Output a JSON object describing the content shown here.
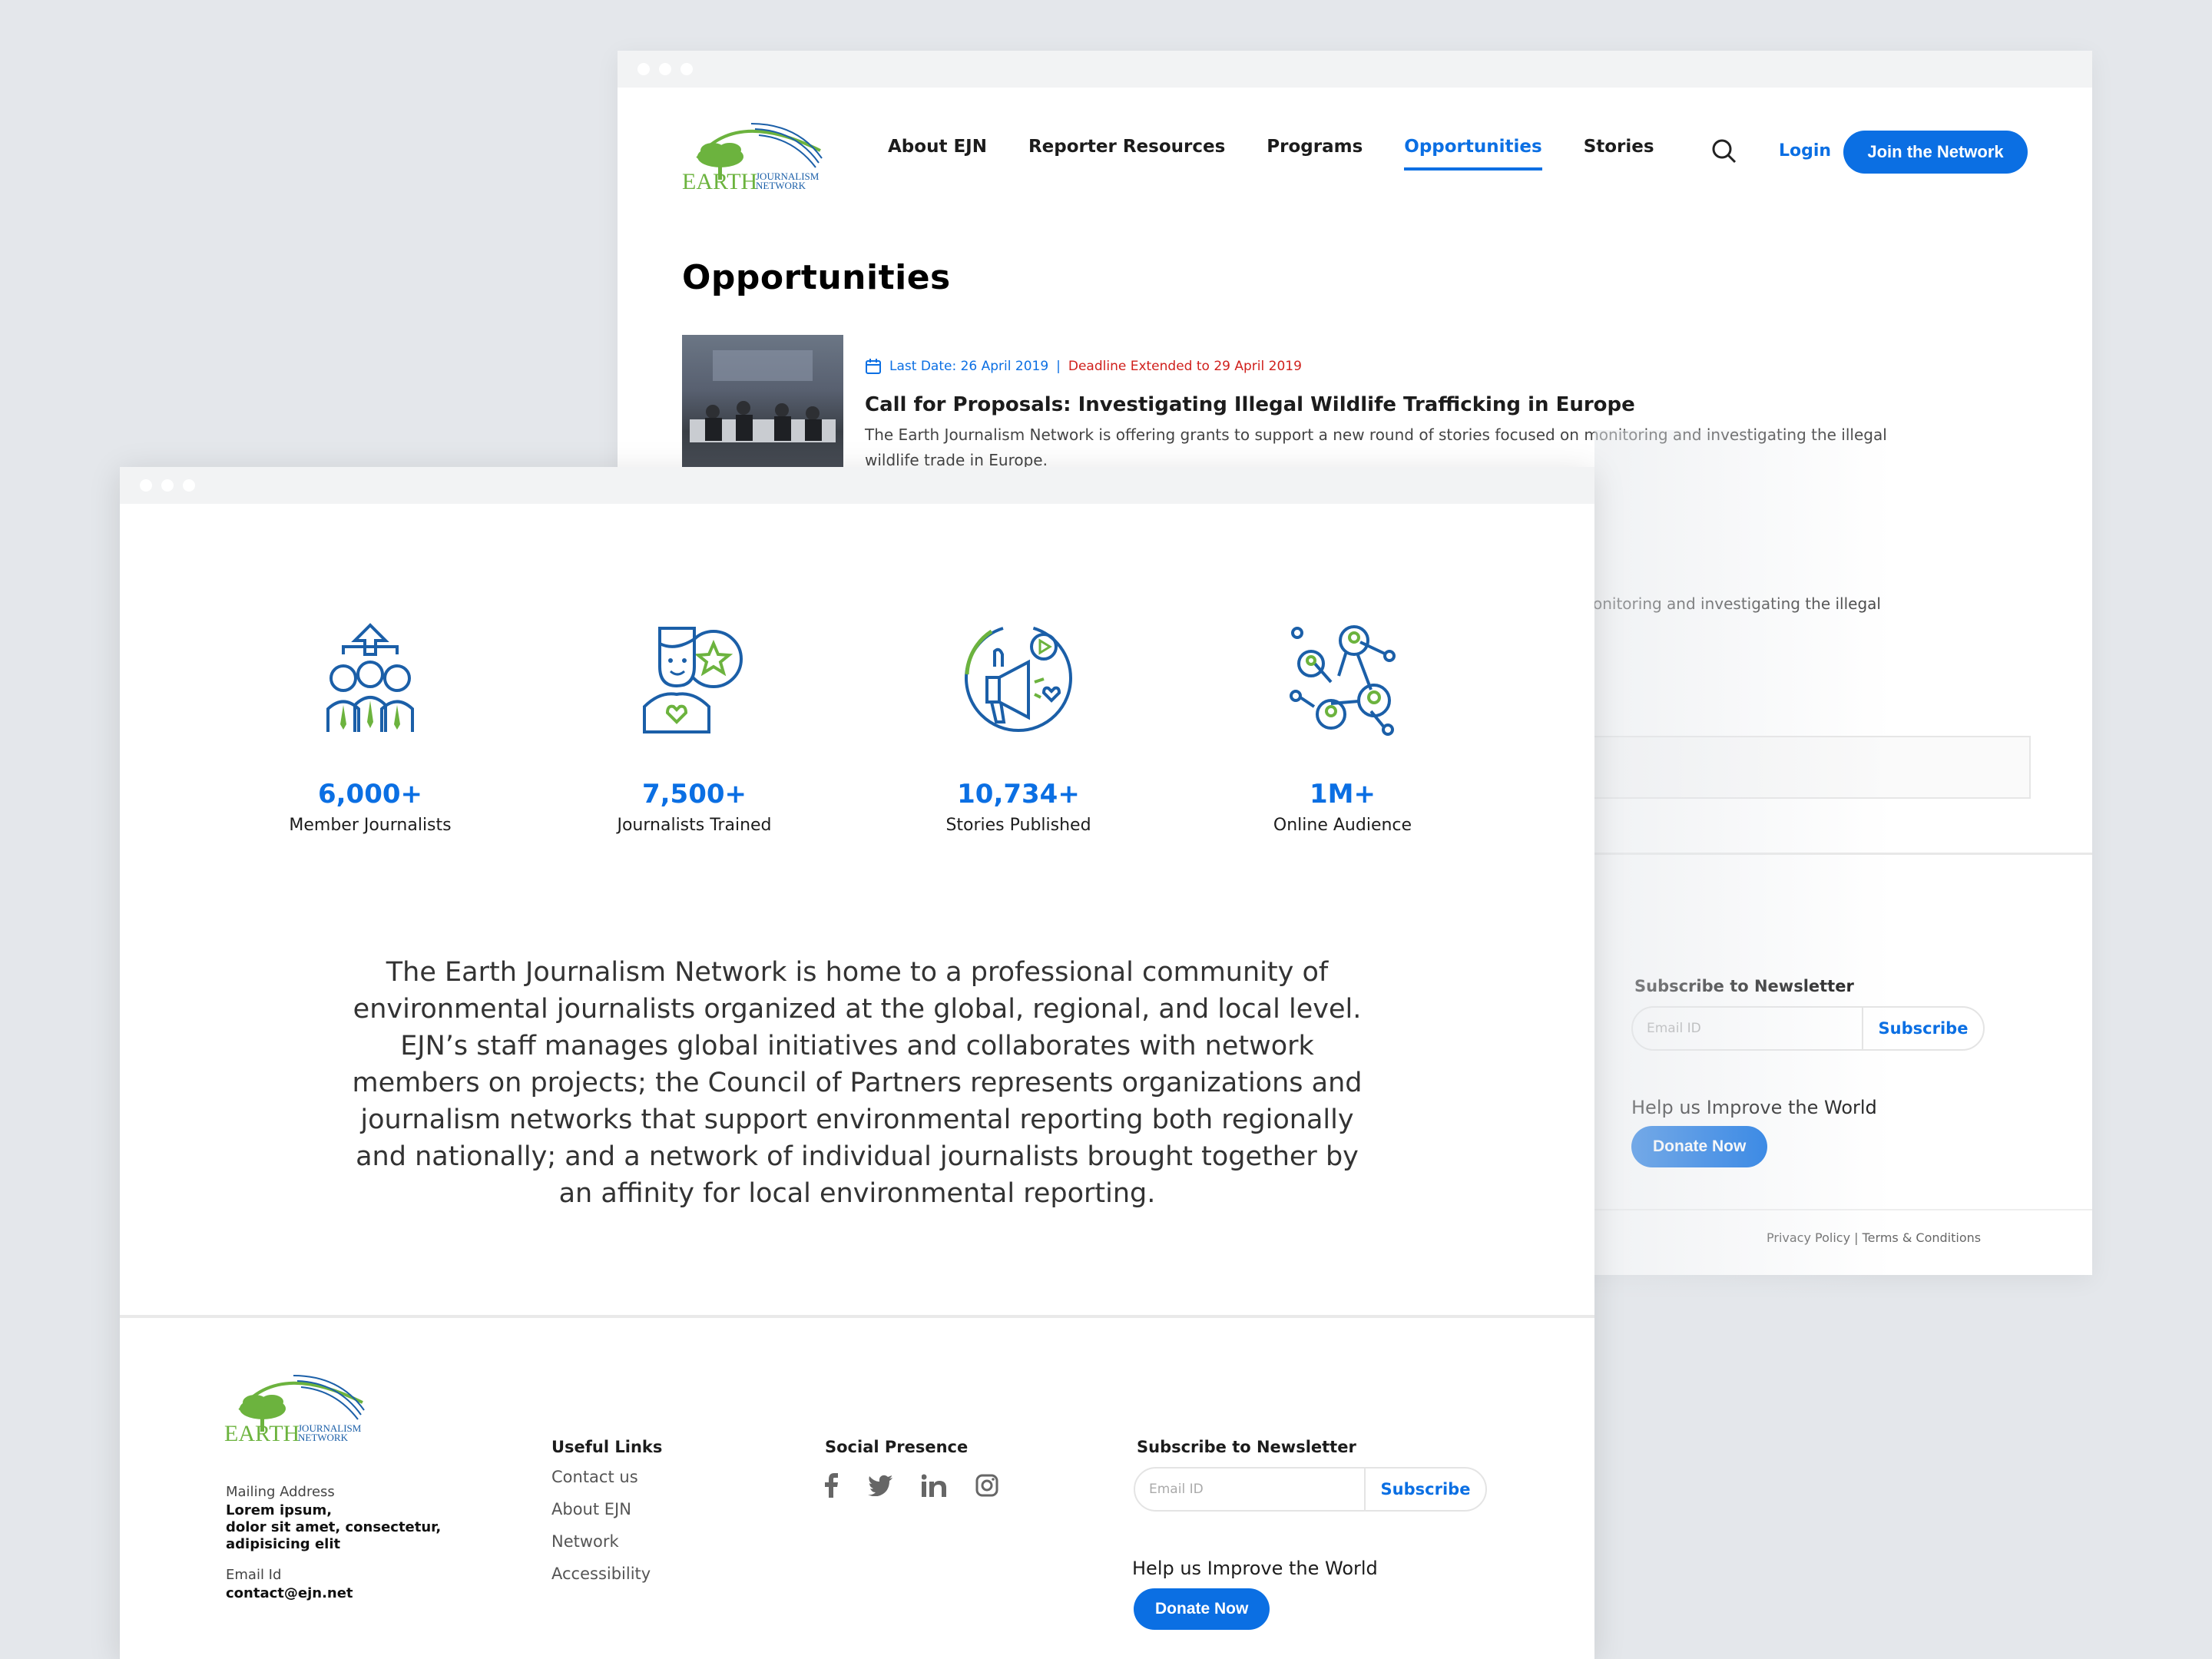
{
  "back_window": {
    "nav": {
      "items": [
        "About EJN",
        "Reporter Resources",
        "Programs",
        "Opportunities",
        "Stories"
      ],
      "active": "Opportunities",
      "login": "Login",
      "join": "Join the Network"
    },
    "page_title": "Opportunities",
    "article": {
      "last_date": "Last Date: 26 April 2019",
      "separator": "|",
      "deadline": "Deadline Extended to 29 April 2019",
      "title": "Call for Proposals: Investigating Illegal Wildlife Trafficking in Europe",
      "description": "The Earth Journalism Network is offering grants to support a new round of stories focused on monitoring and investigating the illegal wildlife trade in Europe.",
      "description_fragment": "onitoring and investigating the illegal"
    },
    "newsletter": {
      "label": "Subscribe to Newsletter",
      "placeholder": "Email ID",
      "button": "Subscribe"
    },
    "help": "Help us Improve the World",
    "donate": "Donate Now",
    "legal": {
      "privacy": "Privacy Policy",
      "sep": "|",
      "terms": "Terms & Conditions"
    }
  },
  "front_window": {
    "stats": [
      {
        "value": "6,000+",
        "label": "Member Journalists"
      },
      {
        "value": "7,500+",
        "label": "Journalists Trained"
      },
      {
        "value": "10,734+",
        "label": "Stories Published"
      },
      {
        "value": "1M+",
        "label": "Online Audience"
      }
    ],
    "about": "The Earth Journalism Network is home to a professional community of environmental journalists organized at the global, regional, and local level. EJN’s staff manages global initiatives and collaborates with network members on projects; the Council of Partners represents organizations and journalism networks that support environmental reporting both regionally and nationally; and a network of individual journalists brought together by an affinity for local environmental reporting.",
    "footer": {
      "mailing_label": "Mailing Address",
      "mailing_lines": [
        "Lorem ipsum,",
        "dolor sit amet, consectetur,",
        "adipisicing elit"
      ],
      "email_label": "Email Id",
      "email": "contact@ejn.net",
      "useful_links_title": "Useful Links",
      "useful_links": [
        "Contact us",
        "About EJN",
        "Network",
        "Accessibility"
      ],
      "social_title": "Social Presence",
      "newsletter": {
        "label": "Subscribe to Newsletter",
        "placeholder": "Email ID",
        "button": "Subscribe"
      },
      "help": "Help us Improve the World",
      "donate": "Donate Now"
    }
  },
  "logo": {
    "word": "EARTH",
    "sub1": "JOURNALISM",
    "sub2": "NETWORK"
  },
  "colors": {
    "accent": "#0b6fe3",
    "deadline": "#d0201c",
    "green": "#6cb33e",
    "icon_blue": "#1b5fa8"
  }
}
